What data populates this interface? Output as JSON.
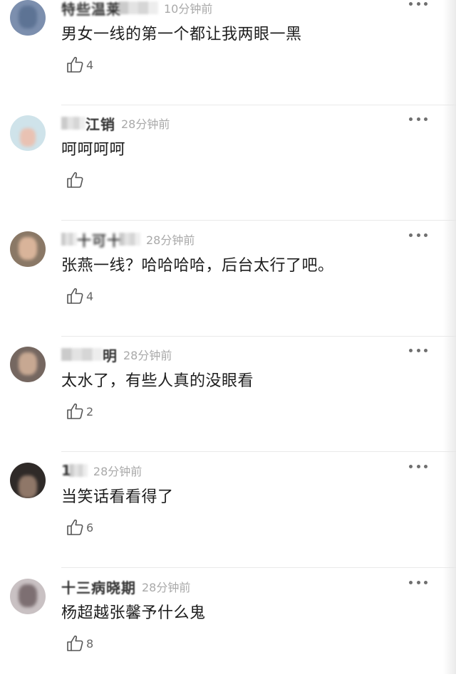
{
  "comments": [
    {
      "username": "特些温莱",
      "time": "10分钟前",
      "text": "男女一线的第一个都让我两眼一黑",
      "likes": "4",
      "avatar_color": "#7c8fae"
    },
    {
      "username": "江销",
      "time": "28分钟前",
      "text": "呵呵呵呵",
      "likes": "",
      "avatar_color": "#a7c8d8"
    },
    {
      "username": "十可十",
      "time": "28分钟前",
      "text": "张燕一线？哈哈哈哈，后台太行了吧。",
      "likes": "4",
      "avatar_color": "#7a6a58"
    },
    {
      "username": "明",
      "time": "28分钟前",
      "text": "太水了，有些人真的没眼看",
      "likes": "2",
      "avatar_color": "#6e5f57"
    },
    {
      "username": "1",
      "time": "28分钟前",
      "text": "当笑话看看得了",
      "likes": "6",
      "avatar_color": "#3a322f"
    },
    {
      "username": "十三病晓期",
      "time": "28分钟前",
      "text": "杨超越张馨予什么鬼",
      "likes": "8",
      "avatar_color": "#b3a8a7"
    }
  ]
}
